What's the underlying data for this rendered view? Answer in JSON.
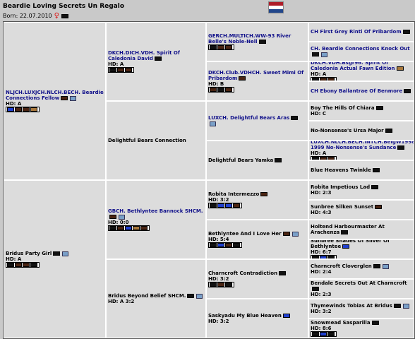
{
  "page": {
    "title": "Beardie Loving Secrets Un Regalo",
    "born_label": "Born: 22.07.2010",
    "flag_colors": [
      "#ae1c28",
      "#ffffff",
      "#21468b"
    ]
  },
  "colors": {
    "black": "#111111",
    "brown": "#4a2412",
    "blue": "#2040d0",
    "fawn": "#a8783c",
    "champion_text": "#10108a"
  },
  "gen1": [
    {
      "name": "NLJCH.LUXJCH.NLCH.BECH. Beardie Connections Fellow",
      "champ": true,
      "hd": "HD: A",
      "swatches": [
        "blu",
        "brn",
        "brn",
        "fwn"
      ],
      "own": "brn",
      "photo": true
    },
    {
      "name": "Bridus Party Girl",
      "champ": false,
      "hd": "HD: A",
      "swatches": [
        "blk",
        "brn",
        "brn",
        "blk"
      ],
      "own": "blk",
      "photo": true
    }
  ],
  "gen2": [
    {
      "name": "DKCH.DICH.VDH. Spirit Of Caledonia David",
      "champ": true,
      "hd": "HD: A",
      "swatches": [
        "blk",
        "brn",
        "brn"
      ],
      "own": "blk"
    },
    {
      "name": "Delightful Bears Connection",
      "champ": false,
      "hd": "",
      "swatches": [],
      "own": ""
    },
    {
      "name": "GBCH. Bethlyntee Bannock SHCM.",
      "champ": true,
      "hd": "HD: 0:0",
      "swatches": [
        "blk",
        "brn",
        "blu",
        "fwn",
        "brn"
      ],
      "own": "brn",
      "photo": true
    },
    {
      "name": "Bridus Beyond Belief SHCM.",
      "champ": false,
      "hd": "HD: A 3:2",
      "swatches": [],
      "own": "blk",
      "photo": true
    }
  ],
  "gen3": [
    {
      "name": "GERCH.MULTICH.WW-93 River Belle's Noble-Nell",
      "champ": true,
      "hd": "",
      "swatches": [
        "blk",
        "brn",
        "brn"
      ],
      "own": "blk"
    },
    {
      "name": "DKCH.Club.VDHCH. Sweet Mimi Of Pribardom",
      "champ": true,
      "hd": "HD: B",
      "swatches": [
        "brn",
        "blk",
        "brn"
      ],
      "own": "brn"
    },
    {
      "name": "LUXCH. Delightful Bears Aras",
      "champ": true,
      "hd": "",
      "swatches": [],
      "own": "blk",
      "photo": true
    },
    {
      "name": "Delightful Bears Yamka",
      "champ": false,
      "hd": "",
      "swatches": [],
      "own": "blk"
    },
    {
      "name": "Robita Intermezzo",
      "champ": false,
      "hd": "HD: 3:2",
      "swatches": [
        "blk",
        "blu",
        "blu",
        "brn"
      ],
      "own": "brn"
    },
    {
      "name": "Bethlyntee And I Love Her",
      "champ": false,
      "hd": "HD: 5:4",
      "swatches": [
        "blk",
        "blu",
        "brn",
        "blk"
      ],
      "own": "brn",
      "photo": true
    },
    {
      "name": "Charncroft Contradiction",
      "champ": false,
      "hd": "HD: 3:2",
      "swatches": [
        "blk",
        "brn",
        "blk"
      ],
      "own": "blk"
    },
    {
      "name": "Saskyadu My Blue Heaven",
      "champ": false,
      "hd": "HD: 3:2",
      "swatches": [],
      "own": "blu"
    }
  ],
  "gen4": [
    {
      "name": "CH First Grey Rinti Of Pribardom",
      "champ": true,
      "hd": "",
      "swatches": [],
      "own": "blk"
    },
    {
      "name": "CH. Beardie Connections Knock Out",
      "champ": true,
      "hd": "",
      "swatches": [],
      "own": "blk",
      "photo": true
    },
    {
      "name": "DKCH.VDH.Bsgr96. Spirit Of Caledonia Actual Fawn Edition",
      "champ": true,
      "hd": "HD: A",
      "swatches": [
        "blk",
        "brn",
        "brn"
      ],
      "own": "fwn"
    },
    {
      "name": "CH Ebony Ballantrae Of Benmore",
      "champ": true,
      "hd": "",
      "swatches": [],
      "own": "blk"
    },
    {
      "name": "Boy The Hills Of Chiara",
      "champ": false,
      "hd": "HD: C",
      "swatches": [],
      "own": "blk"
    },
    {
      "name": "No-Nonsense's Ursa Major",
      "champ": false,
      "hd": "",
      "swatches": [],
      "own": "blk"
    },
    {
      "name": "LUXCH.NLCH.BECH.INTCH.BelgW1998-1999 No-Nonsense's Sundance",
      "champ": true,
      "hd": "HD: A",
      "swatches": [
        "blk",
        "brn",
        "brn"
      ],
      "own": "blk"
    },
    {
      "name": "Blue Heavens Twinkle",
      "champ": false,
      "hd": "",
      "swatches": [],
      "own": "blk"
    },
    {
      "name": "Robita Impetious Lad",
      "champ": false,
      "hd": "HD: 2:3",
      "swatches": [],
      "own": "blk"
    },
    {
      "name": "Sunbree Silken Sunset",
      "champ": false,
      "hd": "HD: 4:3",
      "swatches": [],
      "own": "brn"
    },
    {
      "name": "Holtend Harbourmaster At Arachenza",
      "champ": false,
      "hd": "",
      "swatches": [],
      "own": "blk"
    },
    {
      "name": "Sunbree Shades Of Silver Of Bethlyntee",
      "champ": false,
      "hd": "HD: 6:7",
      "swatches": [
        "blk",
        "blu",
        "blk"
      ],
      "own": "blu"
    },
    {
      "name": "Charncroft Cloverglen",
      "champ": false,
      "hd": "HD: 2:4",
      "swatches": [],
      "own": "blk",
      "photo": true
    },
    {
      "name": "Bendale Secrets Out At Charncroft",
      "champ": false,
      "hd": "HD: 2:3",
      "swatches": [],
      "own": "blk"
    },
    {
      "name": "Thymewinds Tobias At Bridus",
      "champ": false,
      "hd": "HD: 3:2",
      "swatches": [],
      "own": "blk",
      "photo": true
    },
    {
      "name": "Snowmead Sasparilla",
      "champ": false,
      "hd": "HD: 8:6",
      "swatches": [
        "blk",
        "blu",
        "blk"
      ],
      "own": "blk"
    }
  ]
}
